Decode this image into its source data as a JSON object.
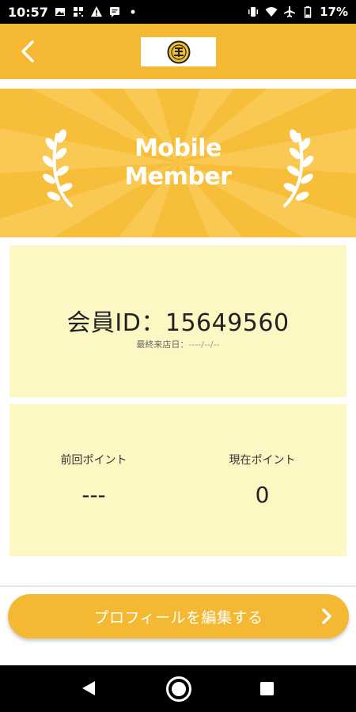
{
  "status_bar": {
    "time": "10:57",
    "battery_percent": "17%",
    "left_icons": [
      "image-icon",
      "qr-icon",
      "warning-icon",
      "message-icon",
      "dot-icon"
    ],
    "right_icons": [
      "vibrate-icon",
      "wifi-icon",
      "airplane-icon",
      "battery-icon"
    ]
  },
  "header": {
    "back_icon": "chevron-left-icon",
    "logo_icon": "brand-logo-icon"
  },
  "banner": {
    "title_line1": "Mobile",
    "title_line2": "Member",
    "decoration": "laurel-icon"
  },
  "member_card": {
    "member_id_label": "会員ID：",
    "member_id": "15649560",
    "last_visit_label": "最終来店日：",
    "last_visit_value": "----/--/--"
  },
  "points_card": {
    "previous_points_label": "前回ポイント",
    "previous_points_value": "---",
    "current_points_label": "現在ポイント",
    "current_points_value": "0"
  },
  "edit_button": {
    "label": "プロフィールを編集する",
    "icon": "chevron-right-icon"
  },
  "nav_bar": {
    "icons": [
      "nav-back-icon",
      "nav-home-icon",
      "nav-recents-icon"
    ]
  },
  "colors": {
    "accent": "#f5b833",
    "banner": "#f7be39",
    "card": "#fdf7c4"
  }
}
